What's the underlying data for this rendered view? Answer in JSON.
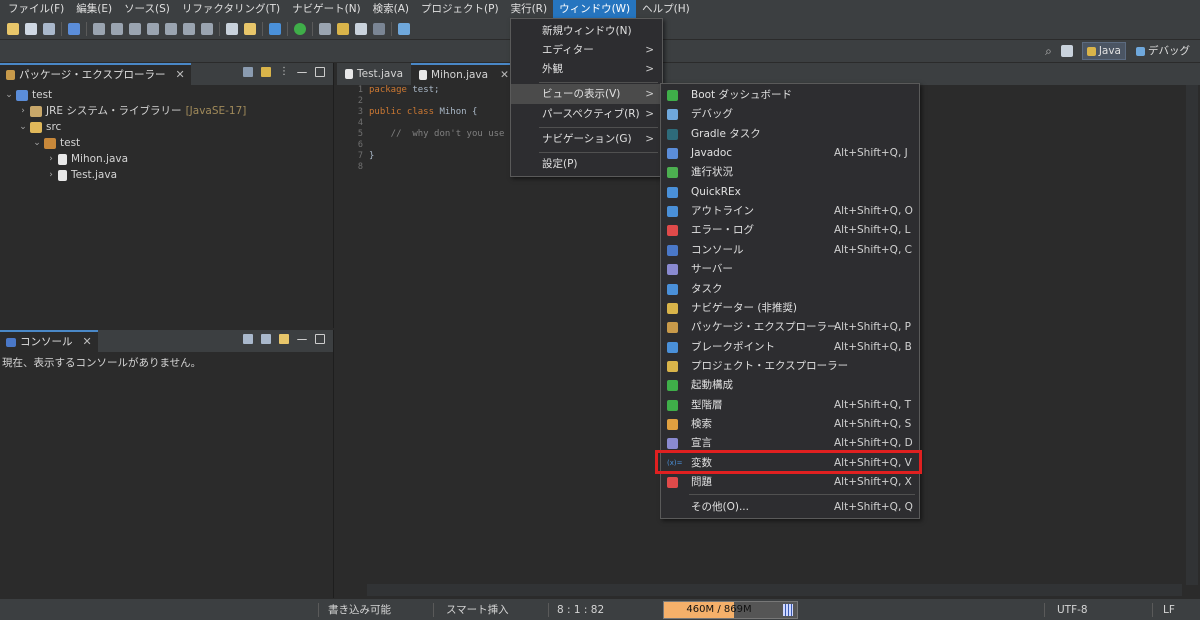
{
  "menubar": {
    "items": [
      "ファイル(F)",
      "編集(E)",
      "ソース(S)",
      "リファクタリング(T)",
      "ナビゲート(N)",
      "検索(A)",
      "プロジェクト(P)",
      "実行(R)",
      "ウィンドウ(W)",
      "ヘルプ(H)"
    ]
  },
  "perspectives": {
    "java": "Java",
    "debug": "デバッグ"
  },
  "package_explorer": {
    "title": "パッケージ・エクスプローラー",
    "tree": {
      "project": "test",
      "jre": "JRE システム・ライブラリー",
      "jre_version": "[JavaSE-17]",
      "src": "src",
      "package": "test",
      "file1": "Mihon.java",
      "file2": "Test.java"
    }
  },
  "console": {
    "title": "コンソール",
    "message": "現在、表示するコンソールがありません。"
  },
  "editor": {
    "tabs": [
      "Test.java",
      "Mihon.java"
    ],
    "line_numbers": [
      "1",
      "2",
      "3",
      "4",
      "5",
      "6",
      "7",
      "8"
    ],
    "code": {
      "l1_kw": "package",
      "l1_rest": " test;",
      "l3_kw": "public class",
      "l3_rest": " Mihon {",
      "l5_comment": "    //  why don't you use k",
      "l7": "}"
    }
  },
  "window_menu": {
    "items": [
      "新規ウィンドウ(N)",
      "エディター",
      "外観",
      "ビューの表示(V)",
      "パースペクティブ(R)",
      "ナビゲーション(G)",
      "設定(P)"
    ],
    "arrow": ">"
  },
  "view_menu": {
    "items": [
      {
        "label": "Boot ダッシュボード",
        "shortcut": "",
        "color": "#3fae49"
      },
      {
        "label": "デバッグ",
        "shortcut": "",
        "color": "#6fa8dc"
      },
      {
        "label": "Gradle タスク",
        "shortcut": "",
        "color": "#2e6b7a"
      },
      {
        "label": "Javadoc",
        "shortcut": "Alt+Shift+Q, J",
        "color": "#5b8dd9"
      },
      {
        "label": "進行状況",
        "shortcut": "",
        "color": "#4caf50"
      },
      {
        "label": "QuickREx",
        "shortcut": "",
        "color": "#4a90d9"
      },
      {
        "label": "アウトライン",
        "shortcut": "Alt+Shift+Q, O",
        "color": "#4a90d9"
      },
      {
        "label": "エラー・ログ",
        "shortcut": "Alt+Shift+Q, L",
        "color": "#e04a4a"
      },
      {
        "label": "コンソール",
        "shortcut": "Alt+Shift+Q, C",
        "color": "#4a78c8"
      },
      {
        "label": "サーバー",
        "shortcut": "",
        "color": "#8a8ad0"
      },
      {
        "label": "タスク",
        "shortcut": "",
        "color": "#4a90d9"
      },
      {
        "label": "ナビゲーター (非推奨)",
        "shortcut": "",
        "color": "#d9b44a"
      },
      {
        "label": "パッケージ・エクスプローラー",
        "shortcut": "Alt+Shift+Q, P",
        "color": "#c89a4a"
      },
      {
        "label": "ブレークポイント",
        "shortcut": "Alt+Shift+Q, B",
        "color": "#4a90d9"
      },
      {
        "label": "プロジェクト・エクスプローラー",
        "shortcut": "",
        "color": "#d9b44a"
      },
      {
        "label": "起動構成",
        "shortcut": "",
        "color": "#3fae49"
      },
      {
        "label": "型階層",
        "shortcut": "Alt+Shift+Q, T",
        "color": "#3fae49"
      },
      {
        "label": "検索",
        "shortcut": "Alt+Shift+Q, S",
        "color": "#e0a040"
      },
      {
        "label": "宣言",
        "shortcut": "Alt+Shift+Q, D",
        "color": "#8a8ad0"
      },
      {
        "label": "変数",
        "shortcut": "Alt+Shift+Q, V",
        "color": "#4a90d9",
        "icon_text": "(x)="
      },
      {
        "label": "問題",
        "shortcut": "Alt+Shift+Q, X",
        "color": "#e04a4a"
      },
      {
        "label": "その他(O)...",
        "shortcut": "Alt+Shift+Q, Q",
        "color": ""
      }
    ]
  },
  "statusbar": {
    "writable": "書き込み可能",
    "insert_mode": "スマート挿入",
    "position": "8 : 1 : 82",
    "heap": "460M / 869M",
    "heap_fraction": 0.53,
    "encoding": "UTF-8",
    "line_ending": "LF"
  },
  "colors": {
    "menu_active": "#2675bf",
    "highlight": "#e02020",
    "heap_fill": "#f5b06a"
  }
}
